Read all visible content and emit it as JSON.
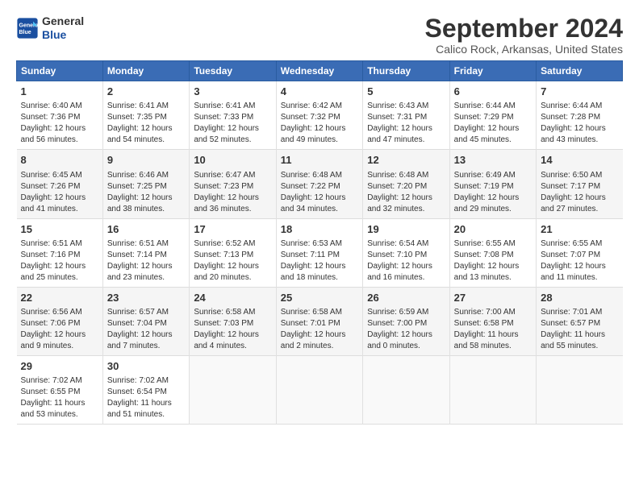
{
  "logo": {
    "line1": "General",
    "line2": "Blue"
  },
  "title": "September 2024",
  "subtitle": "Calico Rock, Arkansas, United States",
  "headers": [
    "Sunday",
    "Monday",
    "Tuesday",
    "Wednesday",
    "Thursday",
    "Friday",
    "Saturday"
  ],
  "weeks": [
    [
      {
        "day": "1",
        "sun": "Sunrise: 6:40 AM",
        "set": "Sunset: 7:36 PM",
        "day_text": "Daylight: 12 hours",
        "min": "and 56 minutes."
      },
      {
        "day": "2",
        "sun": "Sunrise: 6:41 AM",
        "set": "Sunset: 7:35 PM",
        "day_text": "Daylight: 12 hours",
        "min": "and 54 minutes."
      },
      {
        "day": "3",
        "sun": "Sunrise: 6:41 AM",
        "set": "Sunset: 7:33 PM",
        "day_text": "Daylight: 12 hours",
        "min": "and 52 minutes."
      },
      {
        "day": "4",
        "sun": "Sunrise: 6:42 AM",
        "set": "Sunset: 7:32 PM",
        "day_text": "Daylight: 12 hours",
        "min": "and 49 minutes."
      },
      {
        "day": "5",
        "sun": "Sunrise: 6:43 AM",
        "set": "Sunset: 7:31 PM",
        "day_text": "Daylight: 12 hours",
        "min": "and 47 minutes."
      },
      {
        "day": "6",
        "sun": "Sunrise: 6:44 AM",
        "set": "Sunset: 7:29 PM",
        "day_text": "Daylight: 12 hours",
        "min": "and 45 minutes."
      },
      {
        "day": "7",
        "sun": "Sunrise: 6:44 AM",
        "set": "Sunset: 7:28 PM",
        "day_text": "Daylight: 12 hours",
        "min": "and 43 minutes."
      }
    ],
    [
      {
        "day": "8",
        "sun": "Sunrise: 6:45 AM",
        "set": "Sunset: 7:26 PM",
        "day_text": "Daylight: 12 hours",
        "min": "and 41 minutes."
      },
      {
        "day": "9",
        "sun": "Sunrise: 6:46 AM",
        "set": "Sunset: 7:25 PM",
        "day_text": "Daylight: 12 hours",
        "min": "and 38 minutes."
      },
      {
        "day": "10",
        "sun": "Sunrise: 6:47 AM",
        "set": "Sunset: 7:23 PM",
        "day_text": "Daylight: 12 hours",
        "min": "and 36 minutes."
      },
      {
        "day": "11",
        "sun": "Sunrise: 6:48 AM",
        "set": "Sunset: 7:22 PM",
        "day_text": "Daylight: 12 hours",
        "min": "and 34 minutes."
      },
      {
        "day": "12",
        "sun": "Sunrise: 6:48 AM",
        "set": "Sunset: 7:20 PM",
        "day_text": "Daylight: 12 hours",
        "min": "and 32 minutes."
      },
      {
        "day": "13",
        "sun": "Sunrise: 6:49 AM",
        "set": "Sunset: 7:19 PM",
        "day_text": "Daylight: 12 hours",
        "min": "and 29 minutes."
      },
      {
        "day": "14",
        "sun": "Sunrise: 6:50 AM",
        "set": "Sunset: 7:17 PM",
        "day_text": "Daylight: 12 hours",
        "min": "and 27 minutes."
      }
    ],
    [
      {
        "day": "15",
        "sun": "Sunrise: 6:51 AM",
        "set": "Sunset: 7:16 PM",
        "day_text": "Daylight: 12 hours",
        "min": "and 25 minutes."
      },
      {
        "day": "16",
        "sun": "Sunrise: 6:51 AM",
        "set": "Sunset: 7:14 PM",
        "day_text": "Daylight: 12 hours",
        "min": "and 23 minutes."
      },
      {
        "day": "17",
        "sun": "Sunrise: 6:52 AM",
        "set": "Sunset: 7:13 PM",
        "day_text": "Daylight: 12 hours",
        "min": "and 20 minutes."
      },
      {
        "day": "18",
        "sun": "Sunrise: 6:53 AM",
        "set": "Sunset: 7:11 PM",
        "day_text": "Daylight: 12 hours",
        "min": "and 18 minutes."
      },
      {
        "day": "19",
        "sun": "Sunrise: 6:54 AM",
        "set": "Sunset: 7:10 PM",
        "day_text": "Daylight: 12 hours",
        "min": "and 16 minutes."
      },
      {
        "day": "20",
        "sun": "Sunrise: 6:55 AM",
        "set": "Sunset: 7:08 PM",
        "day_text": "Daylight: 12 hours",
        "min": "and 13 minutes."
      },
      {
        "day": "21",
        "sun": "Sunrise: 6:55 AM",
        "set": "Sunset: 7:07 PM",
        "day_text": "Daylight: 12 hours",
        "min": "and 11 minutes."
      }
    ],
    [
      {
        "day": "22",
        "sun": "Sunrise: 6:56 AM",
        "set": "Sunset: 7:06 PM",
        "day_text": "Daylight: 12 hours",
        "min": "and 9 minutes."
      },
      {
        "day": "23",
        "sun": "Sunrise: 6:57 AM",
        "set": "Sunset: 7:04 PM",
        "day_text": "Daylight: 12 hours",
        "min": "and 7 minutes."
      },
      {
        "day": "24",
        "sun": "Sunrise: 6:58 AM",
        "set": "Sunset: 7:03 PM",
        "day_text": "Daylight: 12 hours",
        "min": "and 4 minutes."
      },
      {
        "day": "25",
        "sun": "Sunrise: 6:58 AM",
        "set": "Sunset: 7:01 PM",
        "day_text": "Daylight: 12 hours",
        "min": "and 2 minutes."
      },
      {
        "day": "26",
        "sun": "Sunrise: 6:59 AM",
        "set": "Sunset: 7:00 PM",
        "day_text": "Daylight: 12 hours",
        "min": "and 0 minutes."
      },
      {
        "day": "27",
        "sun": "Sunrise: 7:00 AM",
        "set": "Sunset: 6:58 PM",
        "day_text": "Daylight: 11 hours",
        "min": "and 58 minutes."
      },
      {
        "day": "28",
        "sun": "Sunrise: 7:01 AM",
        "set": "Sunset: 6:57 PM",
        "day_text": "Daylight: 11 hours",
        "min": "and 55 minutes."
      }
    ],
    [
      {
        "day": "29",
        "sun": "Sunrise: 7:02 AM",
        "set": "Sunset: 6:55 PM",
        "day_text": "Daylight: 11 hours",
        "min": "and 53 minutes."
      },
      {
        "day": "30",
        "sun": "Sunrise: 7:02 AM",
        "set": "Sunset: 6:54 PM",
        "day_text": "Daylight: 11 hours",
        "min": "and 51 minutes."
      },
      null,
      null,
      null,
      null,
      null
    ]
  ]
}
